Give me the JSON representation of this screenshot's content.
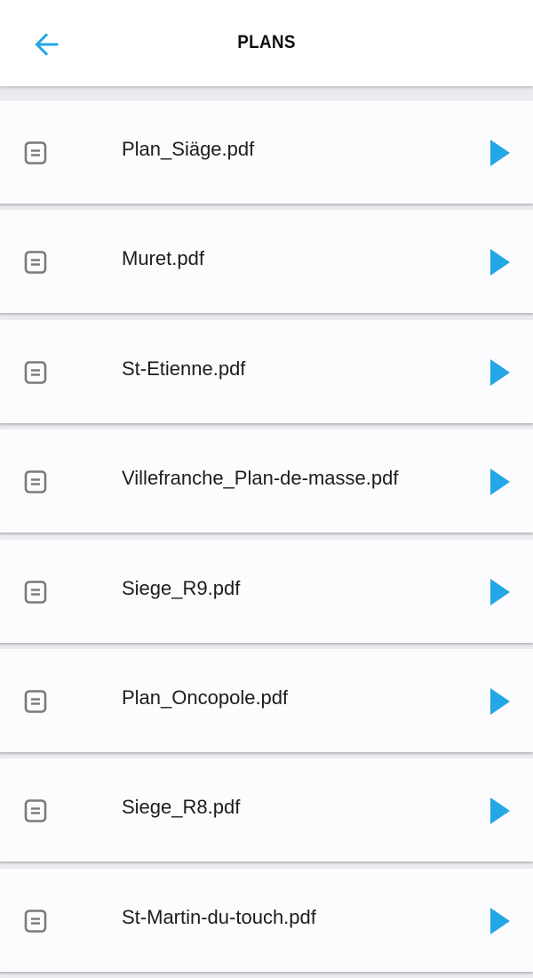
{
  "header": {
    "title": "PLANS",
    "back_icon": "arrow-left-icon",
    "accent_color": "#23a7e6"
  },
  "files": [
    {
      "name": "Plan_Siäge.pdf"
    },
    {
      "name": "Muret.pdf"
    },
    {
      "name": "St-Etienne.pdf"
    },
    {
      "name": "Villefranche_Plan-de-masse.pdf"
    },
    {
      "name": "Siege_R9.pdf"
    },
    {
      "name": "Plan_Oncopole.pdf"
    },
    {
      "name": "Siege_R8.pdf"
    },
    {
      "name": "St-Martin-du-touch.pdf"
    }
  ],
  "icons": {
    "file": "document-icon",
    "open": "play-icon"
  }
}
